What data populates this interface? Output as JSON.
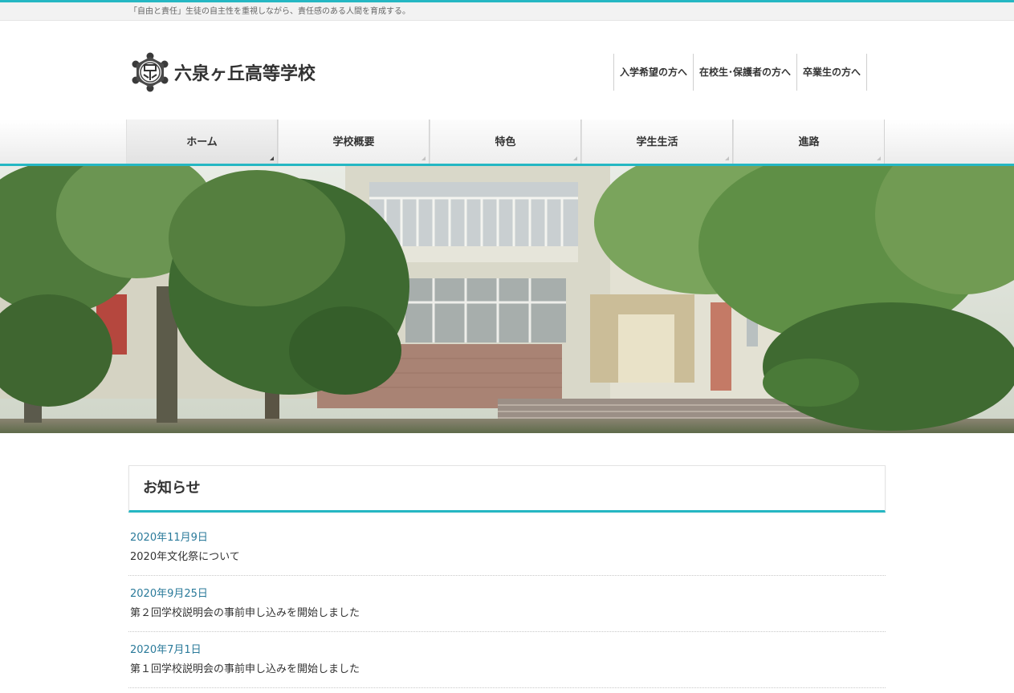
{
  "site": {
    "tagline": "「自由と責任」生徒の自主性を重視しながら、責任感のある人間を育成する。",
    "school_name": "六泉ヶ丘高等学校",
    "logo_icon": "school-crest-icon",
    "accent_color": "#25b7c3"
  },
  "header_links": [
    {
      "label": "入学希望の方へ"
    },
    {
      "label": "在校生･保護者の方へ"
    },
    {
      "label": "卒業生の方へ"
    }
  ],
  "global_nav": [
    {
      "label": "ホーム",
      "active": true
    },
    {
      "label": "学校概要",
      "active": false
    },
    {
      "label": "特色",
      "active": false
    },
    {
      "label": "学生生活",
      "active": false
    },
    {
      "label": "進路",
      "active": false
    }
  ],
  "news": {
    "heading": "お知らせ",
    "items": [
      {
        "date": "2020年11月9日",
        "title": "2020年文化祭について"
      },
      {
        "date": "2020年9月25日",
        "title": "第２回学校説明会の事前申し込みを開始しました"
      },
      {
        "date": "2020年7月1日",
        "title": "第１回学校説明会の事前申し込みを開始しました"
      }
    ]
  }
}
